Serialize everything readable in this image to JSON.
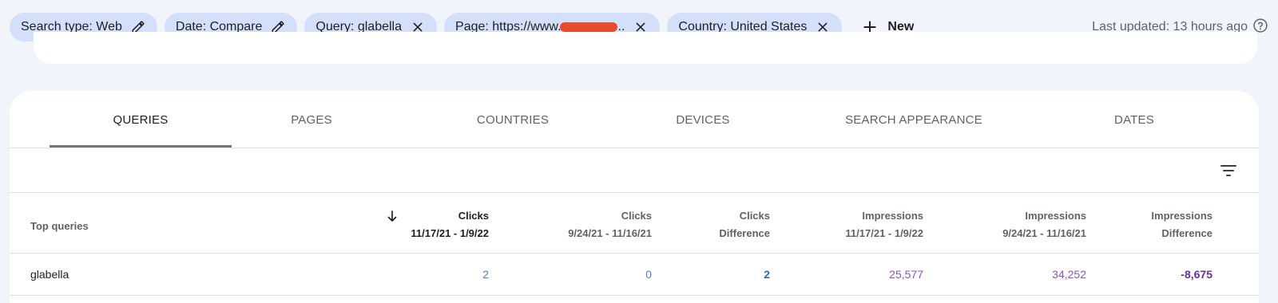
{
  "filters": [
    {
      "label": "Search type: Web",
      "action": "edit"
    },
    {
      "label": "Date: Compare",
      "action": "edit"
    },
    {
      "label": "Query: glabella",
      "action": "remove"
    },
    {
      "label_start": "Page: https://www.",
      "label_end": "..",
      "action": "remove"
    },
    {
      "label": "Country: United States",
      "action": "remove"
    }
  ],
  "new_button": {
    "label": "New"
  },
  "last_updated": "Last updated: 13 hours ago",
  "tabs": [
    "QUERIES",
    "PAGES",
    "COUNTRIES",
    "DEVICES",
    "SEARCH APPEARANCE",
    "DATES"
  ],
  "active_tab": "QUERIES",
  "table": {
    "first_header": "Top queries",
    "columns": [
      {
        "title": "Clicks",
        "sub": "11/17/21 - 1/9/22"
      },
      {
        "title": "Clicks",
        "sub": "9/24/21 - 11/16/21"
      },
      {
        "title": "Clicks",
        "sub": "Difference"
      },
      {
        "title": "Impressions",
        "sub": "11/17/21 - 1/9/22"
      },
      {
        "title": "Impressions",
        "sub": "9/24/21 - 11/16/21"
      },
      {
        "title": "Impressions",
        "sub": "Difference"
      }
    ],
    "sorted_column": "Clicks 11/17/21 - 1/9/22",
    "sort_direction": "descending",
    "rows": [
      {
        "query": "glabella",
        "values": [
          "2",
          "0",
          "2",
          "25,577",
          "34,252",
          "-8,675"
        ]
      }
    ]
  },
  "colors": {
    "clicks": "#4f7fc6",
    "clicks_diff": "#3369c4",
    "impressions": "#8e53bd",
    "impressions_diff": "#6a2f9c",
    "chip_bg": "#d4e0fa",
    "page_bg": "#f1f4fa",
    "redaction": "#e94c2c"
  },
  "icons": {
    "edit": "pencil-icon",
    "remove": "close-icon",
    "new": "plus-icon",
    "help": "help-icon",
    "filter": "filter-list-icon",
    "sort": "arrow-down-icon"
  }
}
